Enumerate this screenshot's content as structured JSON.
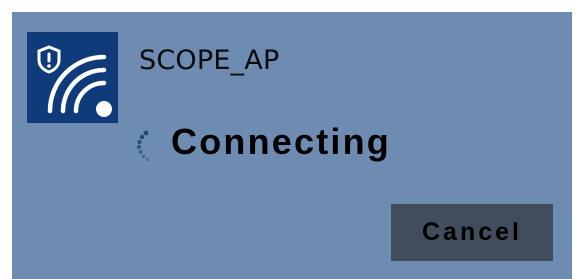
{
  "dialog": {
    "network_icon": "secured-wifi-icon",
    "network_name": "SCOPE_AP",
    "status_icon": "loading-spinner-icon",
    "status_text": "Connecting",
    "cancel_label": "Cancel"
  },
  "colors": {
    "panel_background": "#6e8bb1",
    "icon_tile": "#0f3b7a",
    "button_background": "#414d5d",
    "text": "#000000"
  }
}
